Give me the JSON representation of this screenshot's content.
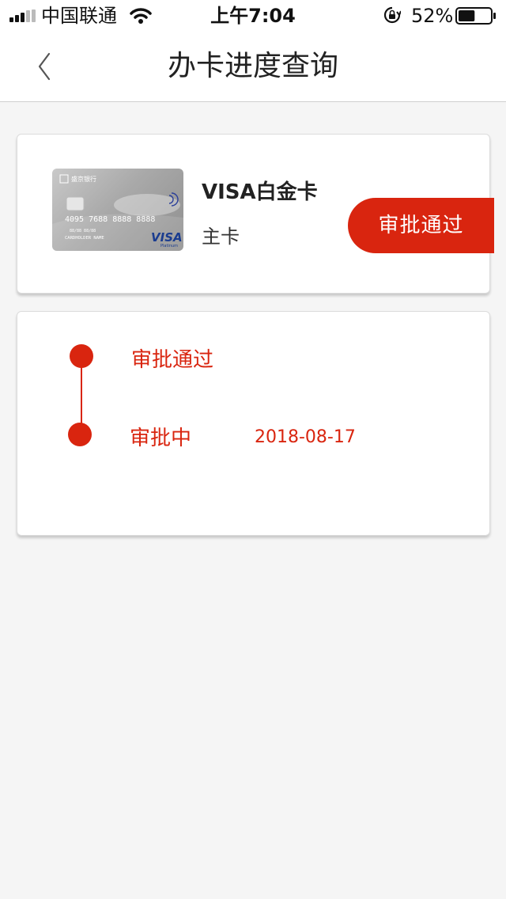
{
  "status_bar": {
    "carrier": "中国联通",
    "time": "上午7:04",
    "battery_percent": "52%",
    "battery_level": 0.52
  },
  "nav": {
    "title": "办卡进度查询",
    "back_icon": "chevron-left-icon"
  },
  "card": {
    "name": "VISA白金卡",
    "type": "主卡",
    "status": "审批通过",
    "image": {
      "bank_name": "盛京银行",
      "number": "4095 7688 8888 8888",
      "valid": "88/88   88/88",
      "holder": "CARDHOLDER NAME",
      "brand": "VISA",
      "tier": "Platinum"
    }
  },
  "progress": {
    "steps": [
      {
        "label": "审批通过",
        "date": ""
      },
      {
        "label": "审批中",
        "date": "2018-08-17"
      }
    ]
  },
  "colors": {
    "accent": "#d9250f",
    "background": "#f5f5f5"
  }
}
